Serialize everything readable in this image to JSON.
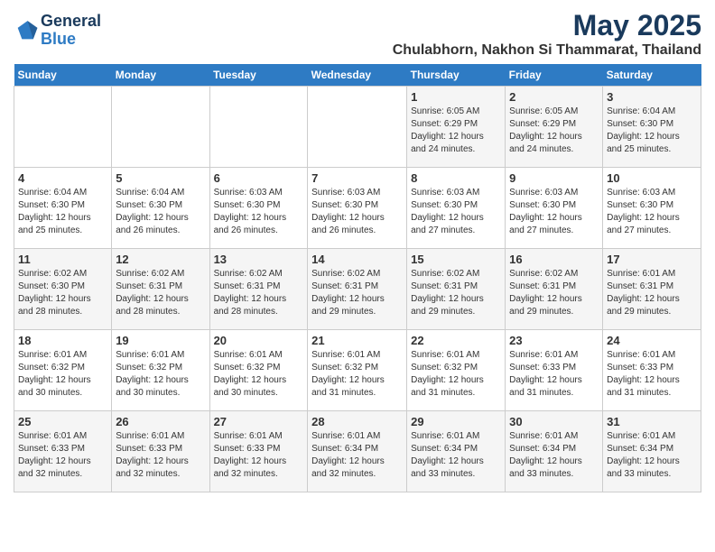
{
  "logo": {
    "text_general": "General",
    "text_blue": "Blue"
  },
  "header": {
    "title": "May 2025",
    "subtitle": "Chulabhorn, Nakhon Si Thammarat, Thailand"
  },
  "days_of_week": [
    "Sunday",
    "Monday",
    "Tuesday",
    "Wednesday",
    "Thursday",
    "Friday",
    "Saturday"
  ],
  "weeks": [
    [
      {
        "day": "",
        "info": ""
      },
      {
        "day": "",
        "info": ""
      },
      {
        "day": "",
        "info": ""
      },
      {
        "day": "",
        "info": ""
      },
      {
        "day": "1",
        "info": "Sunrise: 6:05 AM\nSunset: 6:29 PM\nDaylight: 12 hours\nand 24 minutes."
      },
      {
        "day": "2",
        "info": "Sunrise: 6:05 AM\nSunset: 6:29 PM\nDaylight: 12 hours\nand 24 minutes."
      },
      {
        "day": "3",
        "info": "Sunrise: 6:04 AM\nSunset: 6:30 PM\nDaylight: 12 hours\nand 25 minutes."
      }
    ],
    [
      {
        "day": "4",
        "info": "Sunrise: 6:04 AM\nSunset: 6:30 PM\nDaylight: 12 hours\nand 25 minutes."
      },
      {
        "day": "5",
        "info": "Sunrise: 6:04 AM\nSunset: 6:30 PM\nDaylight: 12 hours\nand 26 minutes."
      },
      {
        "day": "6",
        "info": "Sunrise: 6:03 AM\nSunset: 6:30 PM\nDaylight: 12 hours\nand 26 minutes."
      },
      {
        "day": "7",
        "info": "Sunrise: 6:03 AM\nSunset: 6:30 PM\nDaylight: 12 hours\nand 26 minutes."
      },
      {
        "day": "8",
        "info": "Sunrise: 6:03 AM\nSunset: 6:30 PM\nDaylight: 12 hours\nand 27 minutes."
      },
      {
        "day": "9",
        "info": "Sunrise: 6:03 AM\nSunset: 6:30 PM\nDaylight: 12 hours\nand 27 minutes."
      },
      {
        "day": "10",
        "info": "Sunrise: 6:03 AM\nSunset: 6:30 PM\nDaylight: 12 hours\nand 27 minutes."
      }
    ],
    [
      {
        "day": "11",
        "info": "Sunrise: 6:02 AM\nSunset: 6:30 PM\nDaylight: 12 hours\nand 28 minutes."
      },
      {
        "day": "12",
        "info": "Sunrise: 6:02 AM\nSunset: 6:31 PM\nDaylight: 12 hours\nand 28 minutes."
      },
      {
        "day": "13",
        "info": "Sunrise: 6:02 AM\nSunset: 6:31 PM\nDaylight: 12 hours\nand 28 minutes."
      },
      {
        "day": "14",
        "info": "Sunrise: 6:02 AM\nSunset: 6:31 PM\nDaylight: 12 hours\nand 29 minutes."
      },
      {
        "day": "15",
        "info": "Sunrise: 6:02 AM\nSunset: 6:31 PM\nDaylight: 12 hours\nand 29 minutes."
      },
      {
        "day": "16",
        "info": "Sunrise: 6:02 AM\nSunset: 6:31 PM\nDaylight: 12 hours\nand 29 minutes."
      },
      {
        "day": "17",
        "info": "Sunrise: 6:01 AM\nSunset: 6:31 PM\nDaylight: 12 hours\nand 29 minutes."
      }
    ],
    [
      {
        "day": "18",
        "info": "Sunrise: 6:01 AM\nSunset: 6:32 PM\nDaylight: 12 hours\nand 30 minutes."
      },
      {
        "day": "19",
        "info": "Sunrise: 6:01 AM\nSunset: 6:32 PM\nDaylight: 12 hours\nand 30 minutes."
      },
      {
        "day": "20",
        "info": "Sunrise: 6:01 AM\nSunset: 6:32 PM\nDaylight: 12 hours\nand 30 minutes."
      },
      {
        "day": "21",
        "info": "Sunrise: 6:01 AM\nSunset: 6:32 PM\nDaylight: 12 hours\nand 31 minutes."
      },
      {
        "day": "22",
        "info": "Sunrise: 6:01 AM\nSunset: 6:32 PM\nDaylight: 12 hours\nand 31 minutes."
      },
      {
        "day": "23",
        "info": "Sunrise: 6:01 AM\nSunset: 6:33 PM\nDaylight: 12 hours\nand 31 minutes."
      },
      {
        "day": "24",
        "info": "Sunrise: 6:01 AM\nSunset: 6:33 PM\nDaylight: 12 hours\nand 31 minutes."
      }
    ],
    [
      {
        "day": "25",
        "info": "Sunrise: 6:01 AM\nSunset: 6:33 PM\nDaylight: 12 hours\nand 32 minutes."
      },
      {
        "day": "26",
        "info": "Sunrise: 6:01 AM\nSunset: 6:33 PM\nDaylight: 12 hours\nand 32 minutes."
      },
      {
        "day": "27",
        "info": "Sunrise: 6:01 AM\nSunset: 6:33 PM\nDaylight: 12 hours\nand 32 minutes."
      },
      {
        "day": "28",
        "info": "Sunrise: 6:01 AM\nSunset: 6:34 PM\nDaylight: 12 hours\nand 32 minutes."
      },
      {
        "day": "29",
        "info": "Sunrise: 6:01 AM\nSunset: 6:34 PM\nDaylight: 12 hours\nand 33 minutes."
      },
      {
        "day": "30",
        "info": "Sunrise: 6:01 AM\nSunset: 6:34 PM\nDaylight: 12 hours\nand 33 minutes."
      },
      {
        "day": "31",
        "info": "Sunrise: 6:01 AM\nSunset: 6:34 PM\nDaylight: 12 hours\nand 33 minutes."
      }
    ]
  ]
}
